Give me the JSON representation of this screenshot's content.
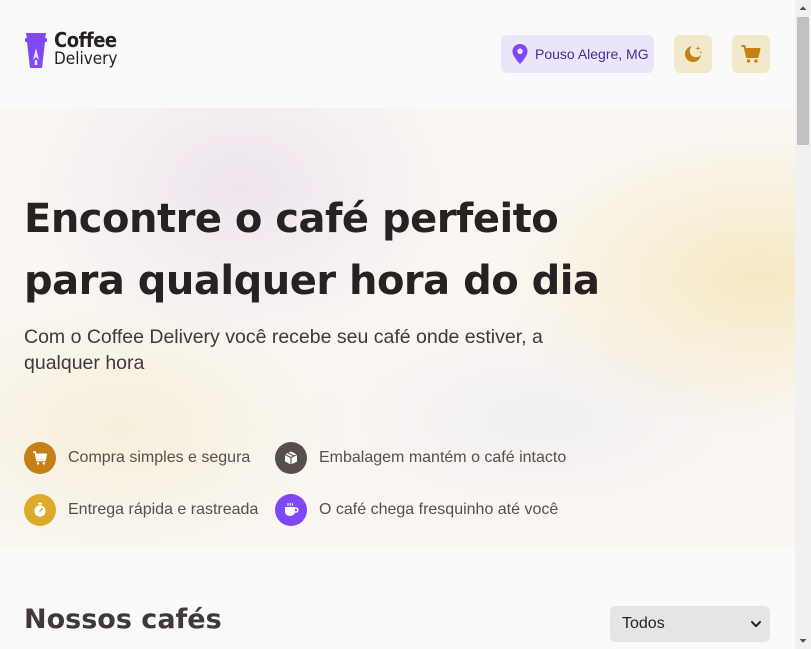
{
  "header": {
    "logo": {
      "line1": "Coffee",
      "line2": "Delivery"
    },
    "location": {
      "label": "Pouso Alegre, MG",
      "icon": "map-pin-icon"
    },
    "theme_button": {
      "icon": "moon-stars-icon"
    },
    "cart_button": {
      "icon": "shopping-cart-icon"
    }
  },
  "hero": {
    "title_line1": "Encontre o café perfeito",
    "title_line2": "para qualquer hora do dia",
    "subtitle": "Com o Coffee Delivery você recebe seu café onde estiver, a qualquer hora",
    "features": [
      {
        "text": "Compra simples e segura",
        "icon": "shopping-cart-icon",
        "color": "#c47f17"
      },
      {
        "text": "Embalagem mantém o café intacto",
        "icon": "package-icon",
        "color": "#574f4d"
      },
      {
        "text": "Entrega rápida e rastreada",
        "icon": "timer-icon",
        "color": "#dbac2c"
      },
      {
        "text": "O café chega fresquinho até você",
        "icon": "coffee-icon",
        "color": "#8047f8"
      }
    ]
  },
  "catalog": {
    "title": "Nossos cafés",
    "filter": {
      "selected": "Todos"
    }
  },
  "colors": {
    "purple": "#8047f8",
    "purple_dark": "#4b2995",
    "purple_light": "#ebe5f9",
    "yellow": "#dbac2c",
    "yellow_dark": "#c47f17",
    "yellow_light": "#f1e9c9",
    "background": "#fafafa"
  }
}
